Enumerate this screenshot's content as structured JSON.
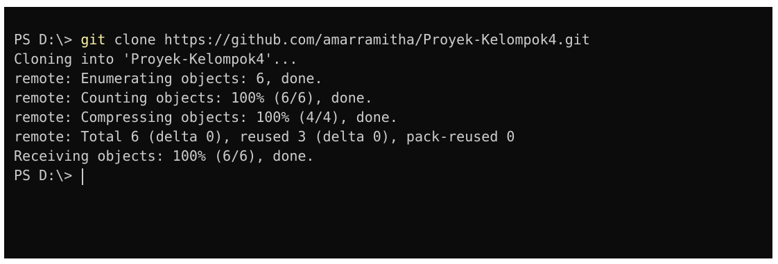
{
  "terminal": {
    "colors": {
      "background": "#0c0c0c",
      "text": "#cccccc",
      "command": "#f9f1a5"
    },
    "lines": [
      {
        "prompt": "PS D:\\> ",
        "command": "git",
        "args": " clone https://github.com/amarramitha/Proyek-Kelompok4.git"
      },
      {
        "text": "Cloning into 'Proyek-Kelompok4'..."
      },
      {
        "text": "remote: Enumerating objects: 6, done."
      },
      {
        "text": "remote: Counting objects: 100% (6/6), done."
      },
      {
        "text": "remote: Compressing objects: 100% (4/4), done."
      },
      {
        "text": "remote: Total 6 (delta 0), reused 3 (delta 0), pack-reused 0"
      },
      {
        "text": "Receiving objects: 100% (6/6), done."
      },
      {
        "prompt": "PS D:\\> "
      }
    ]
  }
}
